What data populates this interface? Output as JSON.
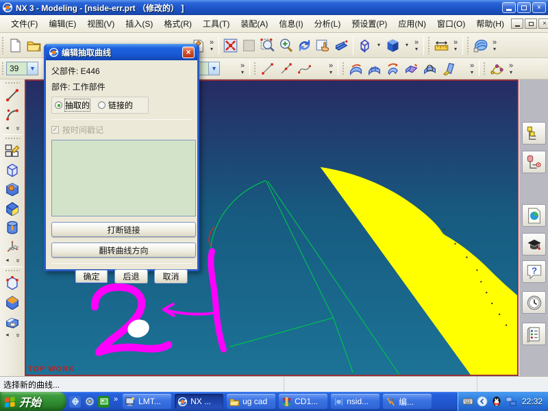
{
  "window": {
    "title": "NX 3 - Modeling - [nside-err.prt （修改的） ]"
  },
  "ui": {
    "overflow": "»",
    "more": "▾",
    "left_arrow": "◄",
    "close": "×",
    "check": "✓"
  },
  "menu": {
    "items": [
      "文件(F)",
      "编辑(E)",
      "视图(V)",
      "插入(S)",
      "格式(R)",
      "工具(T)",
      "装配(A)",
      "信息(I)",
      "分析(L)",
      "预设置(P)",
      "应用(N)",
      "窗口(O)",
      "帮助(H)"
    ]
  },
  "toolbars": {
    "layer_value": "39"
  },
  "dialog": {
    "title": "编辑抽取曲线",
    "parent_part_label": "父部件: E446",
    "part_label": "部件: 工作部件",
    "radio_extracted": "抽取的",
    "radio_linked": "链接的",
    "checkbox_timestamp": "按时间戳记",
    "btn_break_link": "打断链接",
    "btn_reverse_direction": "翻转曲线方向",
    "btn_ok": "确定",
    "btn_back": "后退",
    "btn_cancel": "取消"
  },
  "viewport": {
    "view_label": "TOP WORK"
  },
  "statusbar": {
    "message": "选择新的曲线..."
  },
  "taskbar": {
    "start_label": "开始",
    "buttons": [
      {
        "label": "LMT..."
      },
      {
        "label": "NX ..."
      },
      {
        "label": "ug cad"
      },
      {
        "label": "CD1..."
      },
      {
        "label": "nsid..."
      },
      {
        "label": "编..."
      }
    ],
    "clock": "22:32"
  },
  "colors": {
    "viewport_top": "#272b64",
    "viewport_bottom": "#1c7396",
    "viewport_border": "#96303c",
    "surface_yellow": "#ffff00",
    "curve_green": "#00c050",
    "scribble_magenta": "#ff00ff",
    "view_label_red": "#c02020",
    "taskbar_blue": "#2159d3"
  }
}
